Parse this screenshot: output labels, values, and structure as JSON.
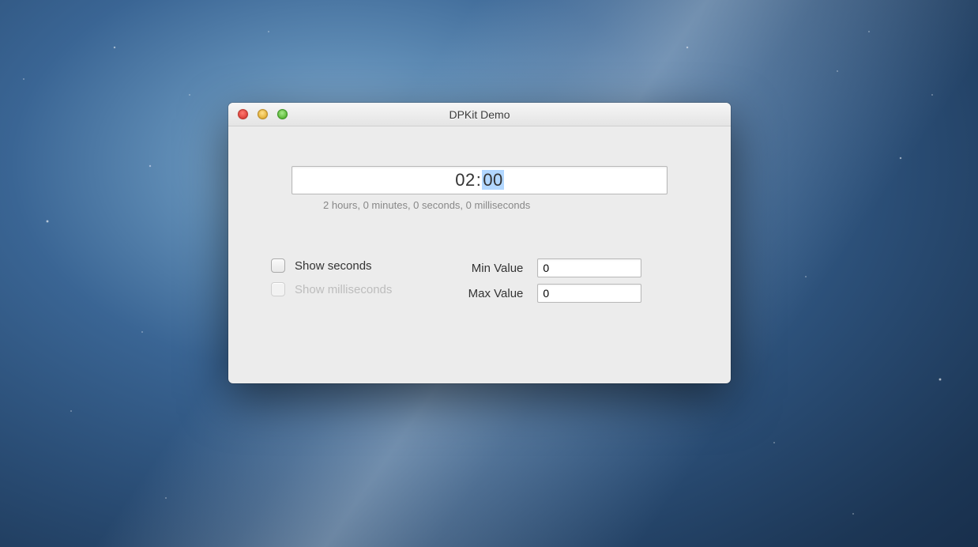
{
  "window": {
    "title": "DPKit Demo"
  },
  "time_input": {
    "hours": "02",
    "separator": ":",
    "minutes": "00"
  },
  "subtitle": "2 hours, 0 minutes, 0 seconds, 0 milliseconds",
  "checkboxes": {
    "show_seconds": {
      "label": "Show seconds",
      "checked": false,
      "enabled": true
    },
    "show_ms": {
      "label": "Show milliseconds",
      "checked": false,
      "enabled": false
    }
  },
  "values": {
    "min": {
      "label": "Min Value",
      "value": "0"
    },
    "max": {
      "label": "Max Value",
      "value": "0"
    }
  }
}
